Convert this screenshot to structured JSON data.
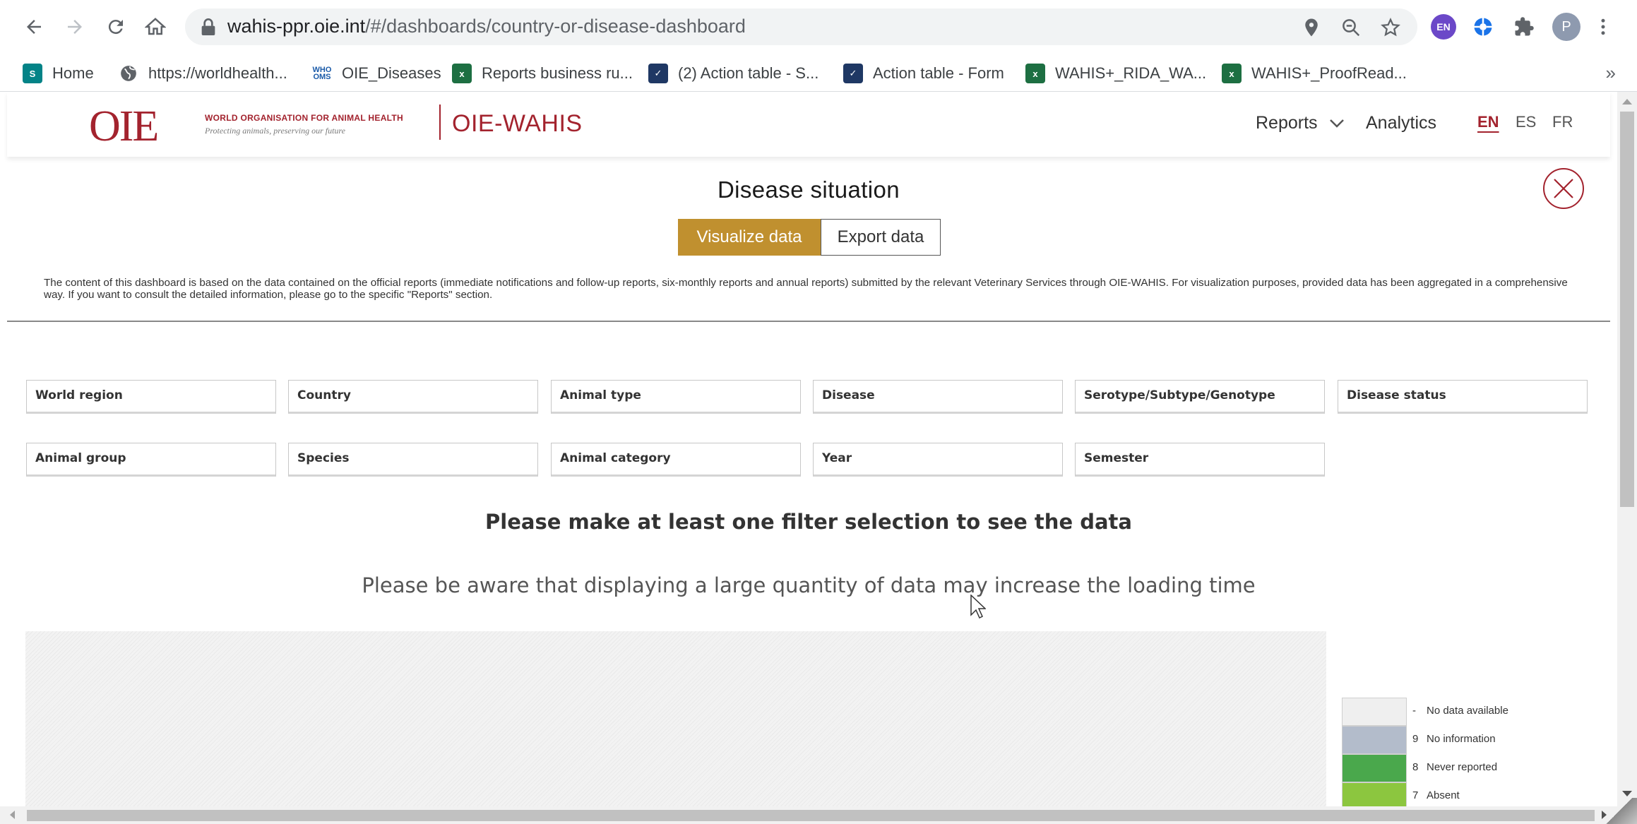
{
  "browser": {
    "url_host": "wahis-ppr.oie.int",
    "url_path": "/#/dashboards/country-or-disease-dashboard",
    "profile_initial": "P",
    "extension_badge": "EN",
    "bookmarks": [
      {
        "label": "Home",
        "icon": "sharepoint-icon"
      },
      {
        "label": "https://worldhealth...",
        "icon": "globe-icon"
      },
      {
        "label": "OIE_Diseases",
        "icon": "who-icon"
      },
      {
        "label": "Reports business ru...",
        "icon": "excel-icon"
      },
      {
        "label": "(2) Action table - S...",
        "icon": "checkbox-icon"
      },
      {
        "label": "Action table - Form",
        "icon": "checkbox-icon"
      },
      {
        "label": "WAHIS+_RIDA_WA...",
        "icon": "excel-icon"
      },
      {
        "label": "WAHIS+_ProofRead...",
        "icon": "excel-icon"
      }
    ],
    "bookmarks_overflow": "»"
  },
  "site": {
    "logo_text": "OIE",
    "org_name": "WORLD ORGANISATION FOR ANIMAL HEALTH",
    "tagline": "Protecting animals, preserving our future",
    "brand": "OIE-WAHIS",
    "nav": {
      "reports": "Reports",
      "analytics": "Analytics"
    },
    "languages": {
      "en": "EN",
      "es": "ES",
      "fr": "FR"
    }
  },
  "dashboard": {
    "title": "Disease situation",
    "tabs": {
      "visualize": "Visualize data",
      "export": "Export data"
    },
    "disclaimer": "The content of this dashboard is based on the data contained on the official reports (immediate notifications and follow-up reports, six-monthly reports and annual reports) submitted by the relevant Veterinary Services through OIE-WAHIS. For visualization purposes, provided data has been aggregated in a comprehensive way. If you want to consult the detailed information, please go to the specific \"Reports\" section.",
    "filters_row1": [
      "World region",
      "Country",
      "Animal type",
      "Disease",
      "Serotype/Subtype/Genotype",
      "Disease status"
    ],
    "filters_row2": [
      "Animal group",
      "Species",
      "Animal category",
      "Year",
      "Semester"
    ],
    "prompt_main": "Please make at least one filter selection to see the data",
    "prompt_sub": "Please be aware that displaying a large quantity of data may increase the loading time",
    "legend": [
      {
        "code": "-",
        "label": "No data available",
        "color": "#efefef"
      },
      {
        "code": "9",
        "label": "No information",
        "color": "#b3bccb"
      },
      {
        "code": "8",
        "label": "Never reported",
        "color": "#4aa84c"
      },
      {
        "code": "7",
        "label": "Absent",
        "color": "#8cc63f"
      }
    ]
  },
  "colors": {
    "accent": "#a3232e",
    "active_tab": "#c0902f"
  }
}
